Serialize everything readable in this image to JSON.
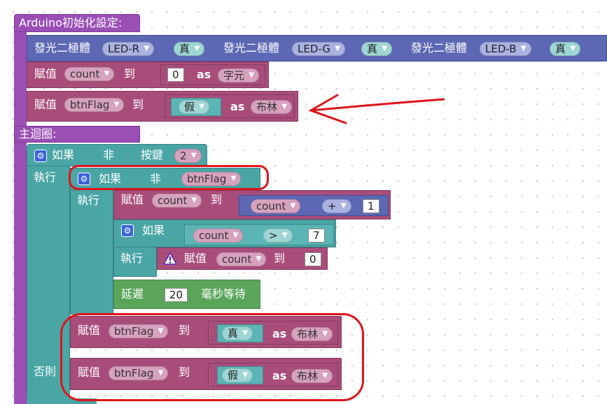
{
  "setup": {
    "title": "Arduino初始化設定:"
  },
  "leds": [
    {
      "label": "發光二極體",
      "pin": "LED-R",
      "value": "真"
    },
    {
      "label": "發光二極體",
      "pin": "LED-G",
      "value": "真"
    },
    {
      "label": "發光二極體",
      "pin": "LED-B",
      "value": "真"
    }
  ],
  "assign_count": {
    "label": "賦值",
    "var": "count",
    "to": "到",
    "value": "0",
    "as": "as",
    "type": "字元"
  },
  "assign_btnflag": {
    "label": "賦值",
    "var": "btnFlag",
    "to": "到",
    "value": "假",
    "as": "as",
    "type": "布林"
  },
  "loop": {
    "title": "主迴圈:"
  },
  "if_outer": {
    "if_label": "如果",
    "not_label": "非",
    "button_label": "按鍵",
    "button_value": "2"
  },
  "do_label": "執行",
  "if_inner": {
    "if_label": "如果",
    "not_label": "非",
    "var": "btnFlag"
  },
  "assign_inc": {
    "label": "賦值",
    "var": "count",
    "to": "到",
    "operand_var": "count",
    "op": "+",
    "num": "1"
  },
  "if_count": {
    "if_label": "如果",
    "var": "count",
    "op": ">",
    "num": "7"
  },
  "reset_count": {
    "label": "賦值",
    "var": "count",
    "to": "到",
    "value": "0"
  },
  "delay": {
    "label": "延遲",
    "value": "20",
    "unit": "毫秒等待"
  },
  "set_true": {
    "label": "賦值",
    "var": "btnFlag",
    "to": "到",
    "value": "真",
    "as": "as",
    "type": "布林"
  },
  "else_label": "否則",
  "set_false": {
    "label": "賦值",
    "var": "btnFlag",
    "to": "到",
    "value": "假",
    "as": "as",
    "type": "布林"
  },
  "colors": {
    "annotation": "#e0141c",
    "setup_purple": "#9a4fb5",
    "variable_maroon": "#a84d7a",
    "logic_teal": "#4aa5a5"
  }
}
